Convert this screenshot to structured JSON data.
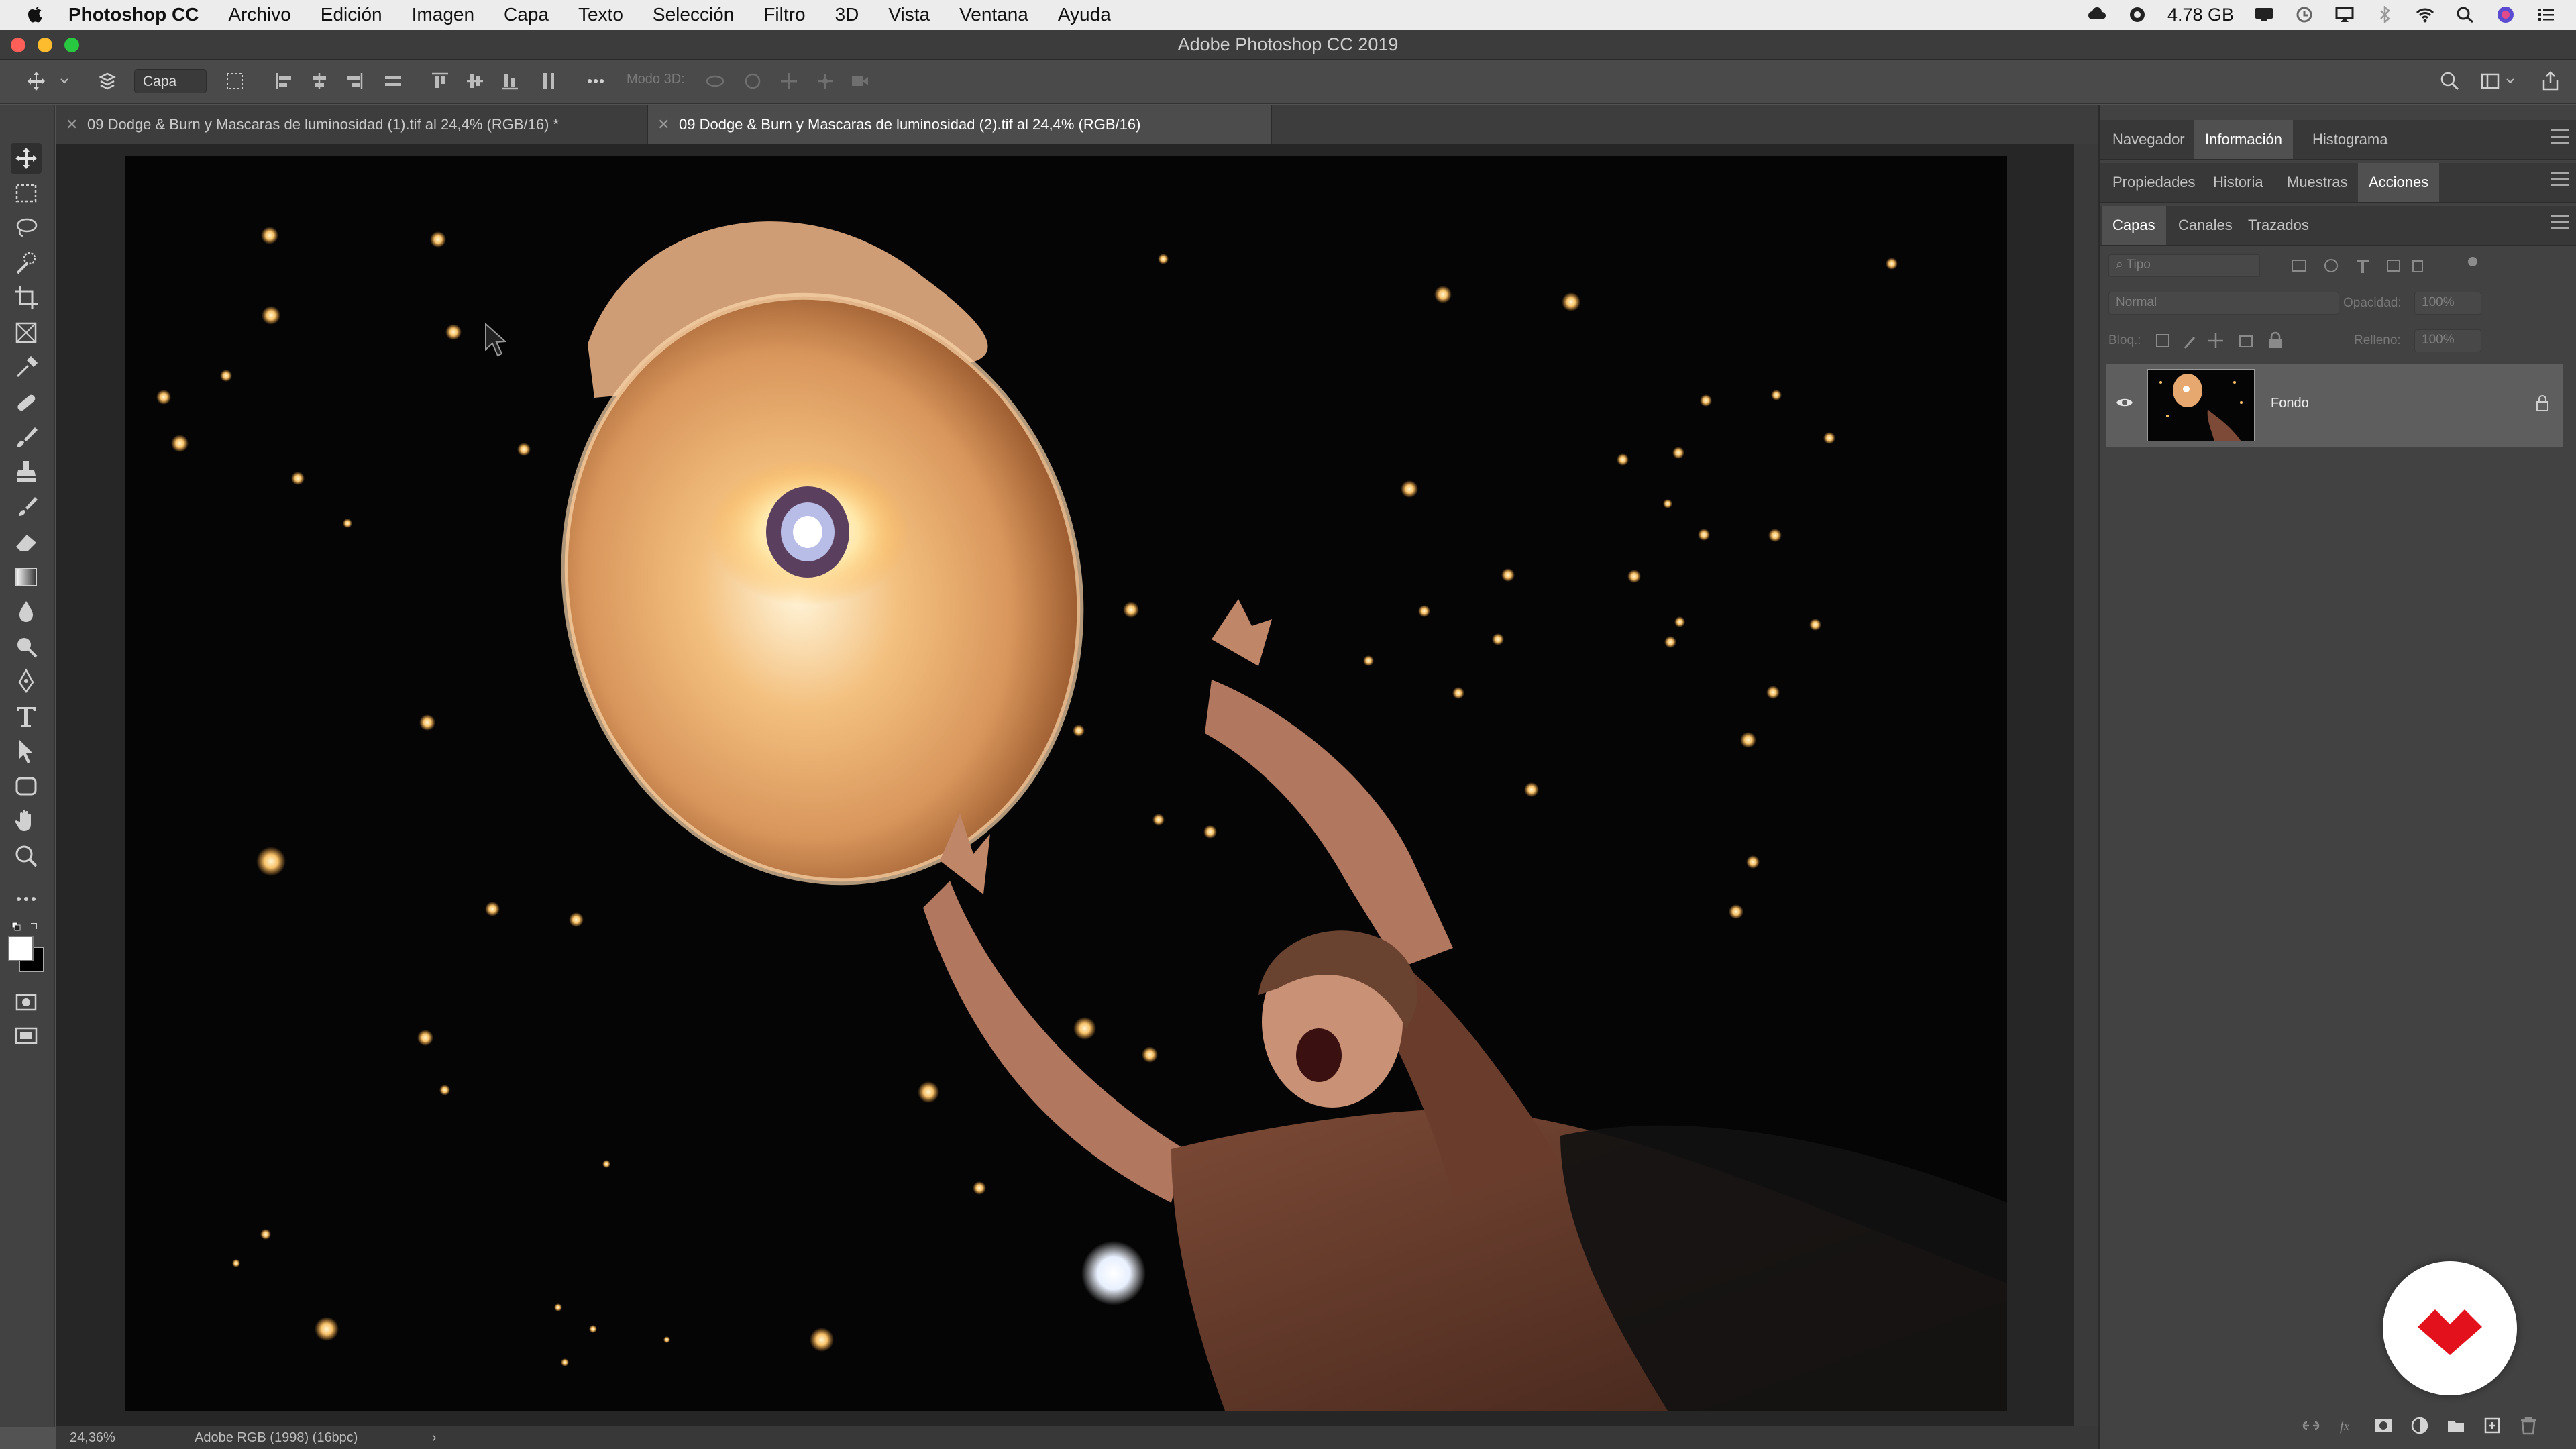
{
  "menubar": {
    "app_name": "Photoshop CC",
    "items": [
      "Archivo",
      "Edición",
      "Imagen",
      "Capa",
      "Texto",
      "Selección",
      "Filtro",
      "3D",
      "Vista",
      "Ventana",
      "Ayuda"
    ],
    "memory": "4.78 GB"
  },
  "window": {
    "title": "Adobe Photoshop CC 2019"
  },
  "options_bar": {
    "layer_select": "Capa",
    "mode_3d": "Modo 3D:"
  },
  "doc_tabs": [
    {
      "label": "09 Dodge & Burn y Mascaras de luminosidad (1).tif al 24,4% (RGB/16) *"
    },
    {
      "label": "09 Dodge & Burn y Mascaras de luminosidad (2).tif al 24,4% (RGB/16)"
    }
  ],
  "status": {
    "zoom": "24,36%",
    "profile": "Adobe RGB (1998) (16bpc)",
    "arrow": "›"
  },
  "panels": {
    "group1": {
      "tabs": [
        "Navegador",
        "Información",
        "Histograma"
      ],
      "active": 1
    },
    "group2": {
      "tabs": [
        "Propiedades",
        "Historia",
        "Muestras",
        "Acciones"
      ],
      "active": 3
    },
    "group3": {
      "tabs": [
        "Capas",
        "Canales",
        "Trazados"
      ],
      "active": 0
    },
    "layers": {
      "filter_placeholder": "Tipo",
      "blend_mode": "Normal",
      "opacity_label": "Opacidad:",
      "opacity_value": "100%",
      "lock_label": "Bloq.:",
      "fill_label": "Relleno:",
      "fill_value": "100%",
      "items": [
        {
          "name": "Fondo",
          "visible": true,
          "locked": true
        }
      ]
    }
  },
  "colors": {
    "accent": "#ffffff",
    "watermark_red": "#e3111b"
  }
}
